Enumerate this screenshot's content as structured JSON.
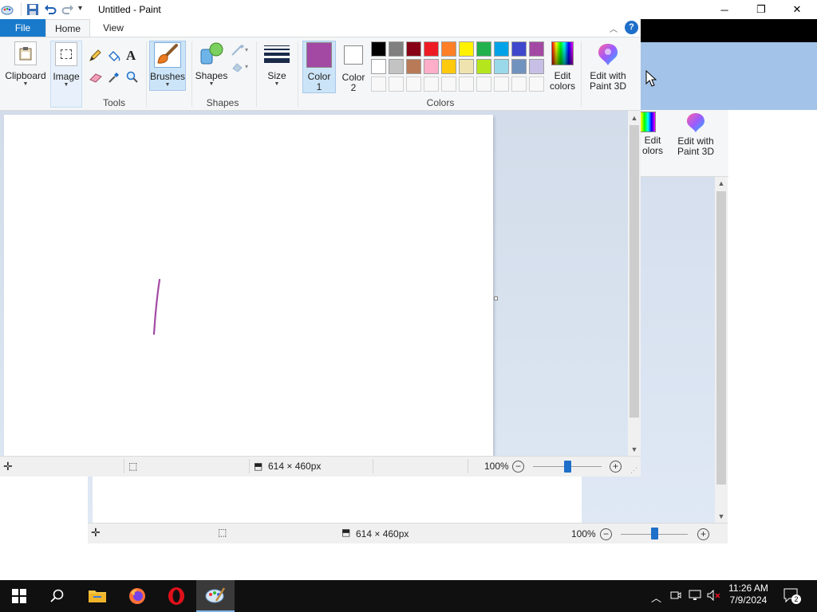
{
  "window": {
    "title": "Untitled - Paint",
    "controls": {
      "minimize": "─",
      "restore": "❐",
      "close": "✕"
    }
  },
  "tabs": [
    {
      "label": "File"
    },
    {
      "label": "Home"
    },
    {
      "label": "View"
    }
  ],
  "ribbon": {
    "clipboard_label": "Clipboard",
    "image_label": "Image",
    "tools_label": "Tools",
    "brushes_label": "Brushes",
    "shapes_label": "Shapes",
    "shapes_group_label": "Shapes",
    "size_label": "Size",
    "color1_label": "Color",
    "color1_num": "1",
    "color2_label": "Color",
    "color2_num": "2",
    "colors_group_label": "Colors",
    "edit_colors_label": "Edit",
    "edit_colors_label2": "colors",
    "edit3d_label": "Edit with",
    "edit3d_label2": "Paint 3D",
    "color1_value": "#a349a4",
    "color2_value": "#ffffff",
    "palette_row1": [
      "#000000",
      "#7f7f7f",
      "#880015",
      "#ed1c24",
      "#ff7f27",
      "#fff200",
      "#22b14c",
      "#00a2e8",
      "#3f48cc",
      "#a349a4"
    ],
    "palette_row2": [
      "#ffffff",
      "#c3c3c3",
      "#b97a57",
      "#ffaec9",
      "#ffc90e",
      "#efe4b0",
      "#b5e61d",
      "#99d9ea",
      "#7092be",
      "#c8bfe7"
    ]
  },
  "status": {
    "canvas_size": "614 × 460px",
    "zoom": "100%",
    "zoom_level": 0.5
  },
  "background_window": {
    "edit_colors_label": "Edit",
    "edit_colors_label2": "olors",
    "edit3d_label": "Edit with",
    "edit3d_label2": "Paint 3D",
    "canvas_size": "614 × 460px",
    "zoom": "100%"
  },
  "taskbar": {
    "time": "11:26 AM",
    "date": "7/9/2024",
    "notification_count": "2"
  }
}
